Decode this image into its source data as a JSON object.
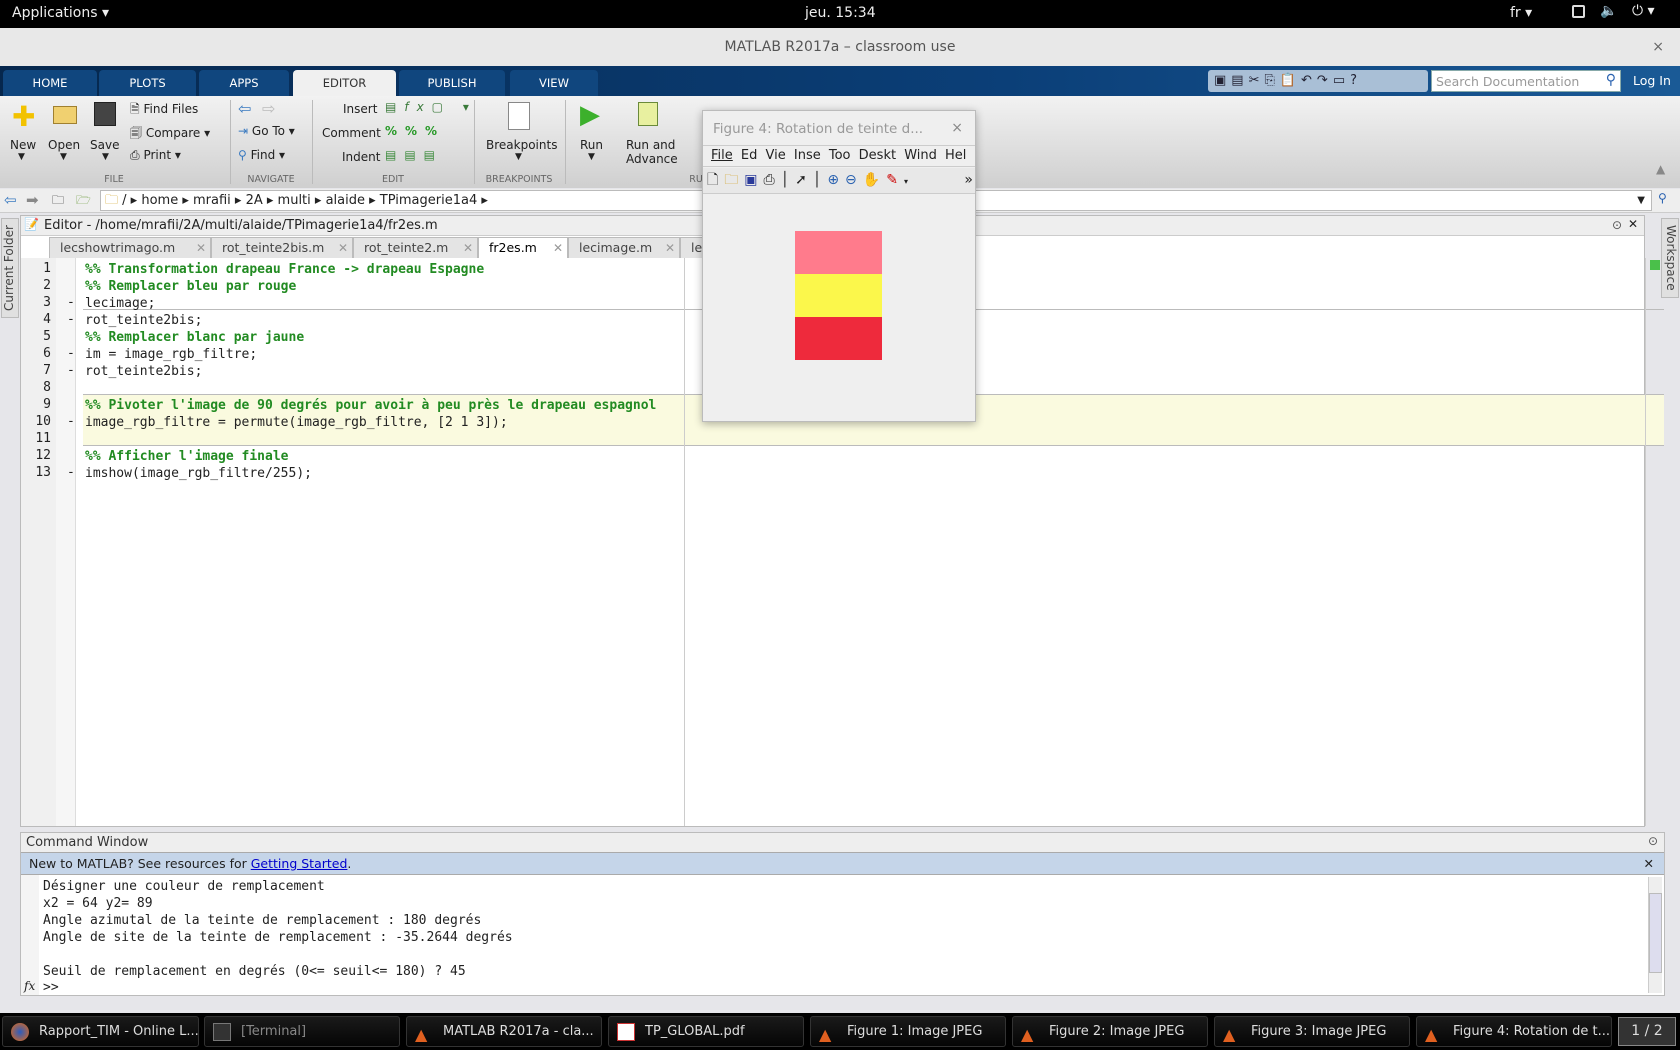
{
  "topbar": {
    "applications": "Applications",
    "clock": "jeu. 15:34",
    "lang": "fr"
  },
  "window": {
    "title": "MATLAB R2017a – classroom use",
    "close": "×"
  },
  "ribbon": {
    "tabs": [
      "HOME",
      "PLOTS",
      "APPS",
      "EDITOR",
      "PUBLISH",
      "VIEW"
    ],
    "active_tab": "EDITOR",
    "search_placeholder": "Search Documentation",
    "login": "Log In"
  },
  "toolstrip": {
    "file": {
      "label": "FILE",
      "new": "New",
      "open": "Open",
      "save": "Save",
      "find_files": "Find Files",
      "compare": "Compare",
      "print": "Print"
    },
    "navigate": {
      "label": "NAVIGATE",
      "goto": "Go To",
      "find": "Find"
    },
    "edit": {
      "label": "EDIT",
      "insert": "Insert",
      "comment": "Comment",
      "indent": "Indent"
    },
    "breakpoints": {
      "label": "BREAKPOINTS",
      "button": "Breakpoints"
    },
    "run": {
      "label": "RU",
      "run": "Run",
      "run_advance_1": "Run and",
      "run_advance_2": "Advance"
    }
  },
  "address": {
    "root": "/",
    "parts": [
      "home",
      "mrafii",
      "2A",
      "multi",
      "alaide",
      "TPimagerie1a4"
    ]
  },
  "side": {
    "left": "Current Folder",
    "right": "Workspace"
  },
  "editor": {
    "title": "Editor - /home/mrafii/2A/multi/alaide/TPimagerie1a4/fr2es.m",
    "tabs": [
      "lecshowtrimago.m",
      "rot_teinte2bis.m",
      "rot_teinte2.m",
      "fr2es.m",
      "lecimage.m",
      "lecsh"
    ],
    "active_tab": "fr2es.m",
    "lines": [
      {
        "n": "1",
        "exec": false,
        "comment": true,
        "text": "%% Transformation drapeau France -> drapeau Espagne"
      },
      {
        "n": "2",
        "exec": false,
        "comment": true,
        "text": "%% Remplacer bleu par rouge"
      },
      {
        "n": "3",
        "exec": true,
        "comment": false,
        "text": "lecimage;"
      },
      {
        "n": "4",
        "exec": true,
        "comment": false,
        "text": "rot_teinte2bis;"
      },
      {
        "n": "5",
        "exec": false,
        "comment": true,
        "text": "%% Remplacer blanc par jaune"
      },
      {
        "n": "6",
        "exec": true,
        "comment": false,
        "text": "im = image_rgb_filtre;"
      },
      {
        "n": "7",
        "exec": true,
        "comment": false,
        "text": "rot_teinte2bis;"
      },
      {
        "n": "8",
        "exec": false,
        "comment": false,
        "text": ""
      },
      {
        "n": "9",
        "exec": false,
        "comment": true,
        "text": "%% Pivoter l'image de 90 degrés pour avoir à peu près le drapeau espagnol"
      },
      {
        "n": "10",
        "exec": true,
        "comment": false,
        "text": "image_rgb_filtre = permute(image_rgb_filtre, [2 1 3]);"
      },
      {
        "n": "11",
        "exec": false,
        "comment": false,
        "text": ""
      },
      {
        "n": "12",
        "exec": false,
        "comment": true,
        "text": "%% Afficher l'image finale"
      },
      {
        "n": "13",
        "exec": true,
        "comment": false,
        "text": "imshow(image_rgb_filtre/255);"
      }
    ]
  },
  "command": {
    "title": "Command Window",
    "info_text": "New to MATLAB? See resources for ",
    "info_link": "Getting Started",
    "info_end": ".",
    "output": [
      "Désigner une couleur de remplacement",
      "x2 = 64 y2= 89",
      "Angle azimutal de la teinte de remplacement : 180 degrés",
      "Angle de site de la teinte de remplacement : -35.2644 degrés",
      "",
      "Seuil de remplacement en degrés (0<= seuil<= 180) ? 45"
    ],
    "prompt": ">>",
    "fx": "fx"
  },
  "figure": {
    "title": "Figure 4: Rotation de teinte d...",
    "close": "×",
    "menu": [
      "File",
      "Ed",
      "Vie",
      "Inse",
      "Too",
      "Deskt",
      "Wind",
      "Hel"
    ],
    "more": "»",
    "flag_colors": [
      "#ff7b8c",
      "#fbf74b",
      "#ee2a3c"
    ]
  },
  "taskbar": {
    "items": [
      "Rapport_TIM - Online L...",
      "[Terminal]",
      "MATLAB R2017a - cla...",
      "TP_GLOBAL.pdf",
      "Figure 1: Image JPEG",
      "Figure 2: Image JPEG",
      "Figure 3: Image JPEG",
      "Figure 4: Rotation de t..."
    ],
    "pager": "1 / 2"
  }
}
